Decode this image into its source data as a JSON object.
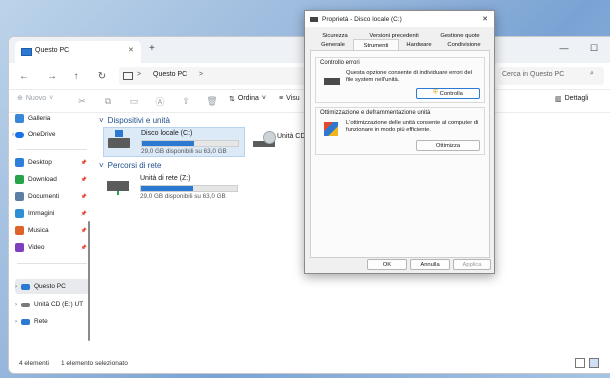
{
  "explorer": {
    "tab_title": "Questo PC",
    "new_tab_glyph": "+",
    "window_controls": {
      "minimize": "—",
      "maximize": "☐",
      "close": "✕"
    },
    "nav": {
      "back_icon": "arrow-left-icon",
      "forward_icon": "arrow-right-icon",
      "up_icon": "arrow-up-icon",
      "refresh_icon": "refresh-icon"
    },
    "address": {
      "location": "Questo PC",
      "sep": ">"
    },
    "search_placeholder": "Cerca in Questo PC",
    "toolbar": {
      "new_label": "Nuovo",
      "sort_label": "Ordina",
      "view_label": "Visu",
      "details_label": "Dettagli"
    },
    "sidebar": {
      "top": [
        {
          "label": "Galleria"
        },
        {
          "label": "OneDrive"
        }
      ],
      "pinned": [
        {
          "label": "Desktop",
          "color": "#2e7fd9"
        },
        {
          "label": "Download",
          "color": "#27a348"
        },
        {
          "label": "Documenti",
          "color": "#5c7fa8"
        },
        {
          "label": "Immagini",
          "color": "#2f8fd6"
        },
        {
          "label": "Musica",
          "color": "#e0622b"
        },
        {
          "label": "Video",
          "color": "#7e3fbf"
        }
      ],
      "bottom": [
        {
          "label": "Questo PC"
        },
        {
          "label": "Unità CD (E:) UT"
        },
        {
          "label": "Rete"
        }
      ]
    },
    "groups": {
      "devices_header": "Dispositivi e unità",
      "network_header": "Percorsi di rete"
    },
    "drives": [
      {
        "name": "Disco locale (C:)",
        "free_text": "29,0 GB disponibili su 63,0 GB",
        "used_fraction": 0.54
      },
      {
        "name": "Unità CD (D:)"
      }
    ],
    "network_drives": [
      {
        "name": "Unità di rete (Z:)",
        "free_text": "29,0 GB disponibili su 63,0 GB",
        "used_fraction": 0.54
      }
    ],
    "status": {
      "count": "4 elementi",
      "selected": "1 elemento selezionato"
    }
  },
  "dialog": {
    "title": "Proprietà - Disco locale (C:)",
    "close_glyph": "✕",
    "tabs_row1": [
      "Sicurezza",
      "Versioni precedenti",
      "Gestione quote"
    ],
    "tabs_row2": [
      "Generale",
      "Strumenti",
      "Hardware",
      "Condivisione"
    ],
    "active_tab": "Strumenti",
    "error_check": {
      "title": "Controllo errori",
      "text": "Questa opzione consente di individuare errori del file system nell'unità.",
      "button": "Controlla"
    },
    "optimize": {
      "title": "Ottimizzazione e deframmentazione unità",
      "text": "L'ottimizzazione delle unità consente al computer di funzionare in modo più efficiente.",
      "button": "Ottimizza"
    },
    "footer": {
      "ok": "OK",
      "cancel": "Annulla",
      "apply": "Applica"
    }
  }
}
